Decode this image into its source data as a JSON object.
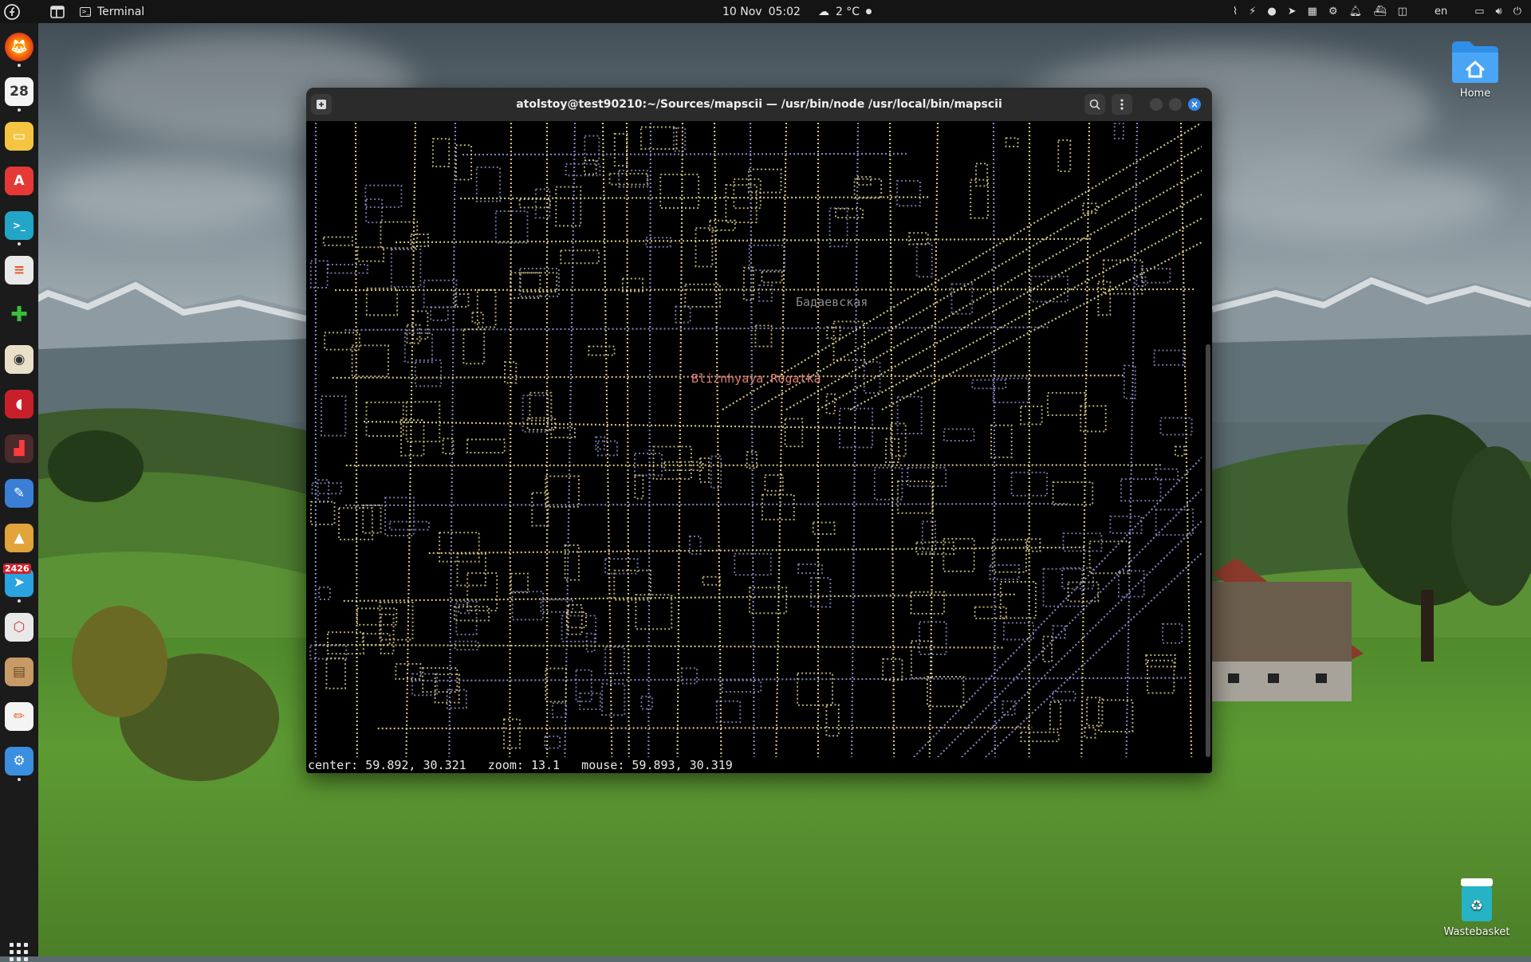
{
  "topbar": {
    "app_name": "Terminal",
    "date": "10 Nov",
    "time": "05:02",
    "weather": "2 °C",
    "language": "en"
  },
  "dock": {
    "calendar_day": "28",
    "telegram_badge": "2426"
  },
  "desktop": {
    "home_label": "Home",
    "trash_label": "Wastebasket"
  },
  "terminal": {
    "title": "atolstoy@test90210:~/Sources/mapscii — /usr/bin/node /usr/local/bin/mapscii",
    "map_labels": {
      "district": "Бадаевская",
      "place": "Bliznhyaya Rogatka"
    },
    "status_line": "center: 59.892, 30.321   zoom: 13.1   mouse: 59.893, 30.319"
  },
  "colors": {
    "accent": "#3584e4",
    "map_yellow": "#f2e29a",
    "map_violet": "#9a9ad8",
    "label_red": "#e07a7a",
    "label_grey": "#8a8a8a"
  }
}
